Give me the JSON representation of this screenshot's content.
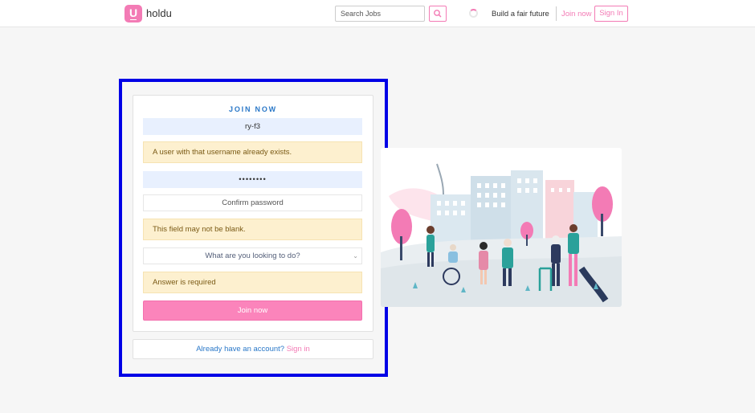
{
  "header": {
    "brand": "holdu",
    "logo_letter": "U",
    "search_placeholder": "Search Jobs",
    "tagline": "Build a fair future",
    "join_label": "Join now",
    "signin_label": "Sign In"
  },
  "form": {
    "title": "JOIN NOW",
    "username_value": "ry-f3",
    "username_error": "A user with that username already exists.",
    "password_value": "••••••••",
    "confirm_placeholder": "Confirm password",
    "confirm_error": "This field may not be blank.",
    "purpose_select": "What are you looking to do?",
    "purpose_error": "Answer is required",
    "submit_label": "Join now"
  },
  "footer_card": {
    "question": "Already have an account?",
    "signin_link": "Sign in"
  },
  "colors": {
    "brand_pink": "#f37bb5",
    "button_pink": "#fb84bb",
    "link_blue": "#2a78c8",
    "alert_bg": "#fdf0cf",
    "autofill_bg": "#e8f0fe",
    "highlight_frame": "#0000e6"
  },
  "icons": {
    "search": "search-icon",
    "loading": "spinner-icon",
    "chevron": "chevron-down-icon"
  }
}
